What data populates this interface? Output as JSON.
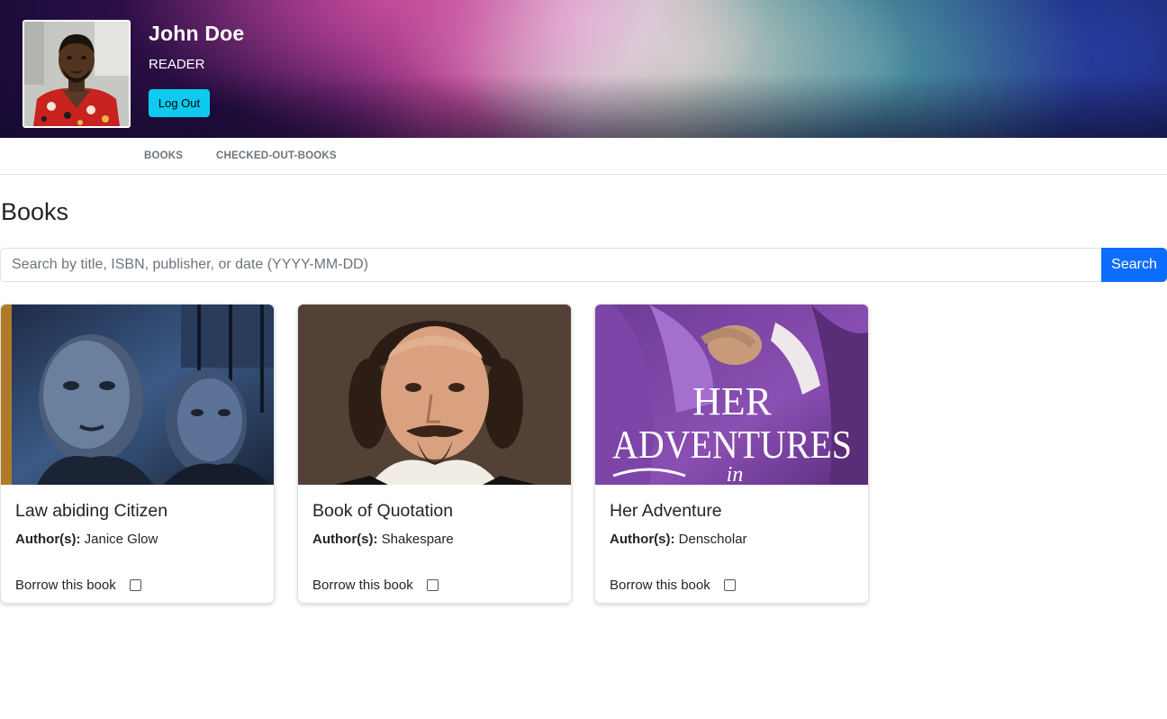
{
  "user": {
    "name": "John Doe",
    "role": "READER",
    "logout_label": "Log Out"
  },
  "nav": {
    "items": [
      {
        "label": "BOOKS"
      },
      {
        "label": "CHECKED-OUT-BOOKS"
      }
    ]
  },
  "main": {
    "title": "Books",
    "search": {
      "placeholder": "Search by title, ISBN, publisher, or date (YYYY-MM-DD)",
      "value": "",
      "button_label": "Search"
    },
    "books": [
      {
        "title": "Law abiding Citizen",
        "author_label": "Author(s):",
        "author": "Janice Glow",
        "borrow_label": "Borrow this book",
        "borrow_checked": false
      },
      {
        "title": "Book of Quotation",
        "author_label": "Author(s):",
        "author": "Shakespare",
        "borrow_label": "Borrow this book",
        "borrow_checked": false
      },
      {
        "title": "Her Adventure",
        "author_label": "Author(s):",
        "author": "Denscholar",
        "borrow_label": "Borrow this book",
        "borrow_checked": false
      }
    ],
    "cover_texts": {
      "her_adventure_line1": "HER",
      "her_adventure_line2": "ADVENTURES",
      "her_adventure_line3": "in"
    }
  },
  "colors": {
    "logout_button": "#0dcaf0",
    "search_button": "#0d6efd",
    "nav_text": "#6c757d"
  }
}
